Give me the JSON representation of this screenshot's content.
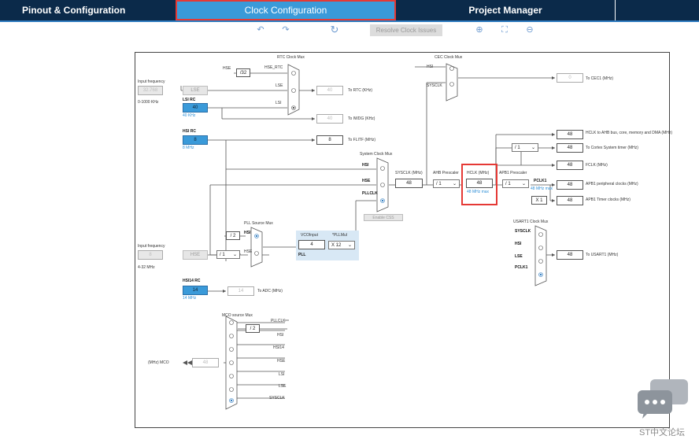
{
  "tabs": {
    "pinout": "Pinout & Configuration",
    "clock": "Clock Configuration",
    "project": "Project Manager"
  },
  "toolbar": {
    "resolve": "Resolve Clock Issues"
  },
  "input_freq": {
    "label": "Input frequency",
    "value": "32.768",
    "range": "0-1000 KHz"
  },
  "input_freq2": {
    "label": "Input frequency",
    "value": "8",
    "range": "4-32 MHz"
  },
  "lse": "LSE",
  "lsi_rc": {
    "label": "LSI RC",
    "value": "40",
    "unit": "40 KHz"
  },
  "hsi_rc": {
    "label": "HSI RC",
    "value": "8",
    "unit": "8 MHz"
  },
  "hse": "HSE",
  "hsi14_rc": {
    "label": "HSI14 RC",
    "value": "14",
    "unit": "14 MHz"
  },
  "rtc_mux": {
    "title": "RTC Clock Mux",
    "hse": "HSE",
    "div": "/32",
    "hse_rtc": "HSE_RTC",
    "lse": "LSE",
    "lsi": "LSI"
  },
  "rtc_out": {
    "value": "40",
    "label": "To RTC (KHz)"
  },
  "iwdg_out": {
    "value": "40",
    "label": "To IWDG (KHz)"
  },
  "flitf_out": {
    "value": "8",
    "label": "To FLITF (MHz)"
  },
  "cec_mux": {
    "title": "CEC Clock Mux",
    "hsi": "HSI",
    "sysclk": "SYSCLK"
  },
  "cec_out": {
    "value": "0",
    "label": "To CEC1 (MHz)"
  },
  "sys_mux": {
    "title": "System Clock Mux",
    "hsi": "HSI",
    "hse": "HSE",
    "pllclk": "PLLCLK",
    "css": "Enable CSS"
  },
  "sysclk": {
    "label": "SYSCLK (MHz)",
    "value": "48"
  },
  "ahb": {
    "label": "AHB Prescaler",
    "value": "/ 1"
  },
  "hclk": {
    "label": "HCLK (MHz)",
    "value": "48",
    "max": "48 MHz max"
  },
  "apb1": {
    "label": "APB1 Prescaler",
    "value": "/ 1",
    "pclk1": "PCLK1",
    "max": "48 MHz max"
  },
  "outputs": [
    {
      "value": "48",
      "label": "HCLK to AHB bus, core, memory and DMA (MHz)"
    },
    {
      "value": "48",
      "label": "To Cortex System timer (MHz)"
    },
    {
      "value": "48",
      "label": "FCLK (MHz)"
    },
    {
      "value": "48",
      "label": "APB1 peripheral clocks (MHz)"
    },
    {
      "value": "48",
      "label": "APB1 Timer clocks (MHz)"
    }
  ],
  "cortex_div": "/ 1",
  "timer_mul": "X 1",
  "pll_mux": {
    "title": "PLL Source Mux",
    "div": "/ 2",
    "hsi": "HSI",
    "hse": "HSE"
  },
  "prediv": "/ 1",
  "vco": {
    "label": "VCOInput",
    "value": "4",
    "pllmul": "*PLLMul",
    "mul": "X 12",
    "pll": "PLL"
  },
  "adc_out": {
    "value": "14",
    "label": "To ADC (MHz)"
  },
  "usart_mux": {
    "title": "USART1 Clock Mux",
    "items": [
      "SYSCLK",
      "HSI",
      "LSE",
      "PCLK1"
    ]
  },
  "usart_out": {
    "value": "48",
    "label": "To USART1 (MHz)"
  },
  "mco_mux": {
    "title": "MCO source Mux",
    "div": "/ 2",
    "items": [
      "PLLCLK",
      "HSI",
      "HSI14",
      "HSE",
      "LSI",
      "LSE",
      "SYSCLK"
    ]
  },
  "mco_out": {
    "label": "(MHz) MCO",
    "value": "48"
  },
  "watermark": "ST中文论坛",
  "colors": {
    "accent": "#3a9ad9",
    "navy": "#0b2a4a",
    "highlight": "#e53935"
  }
}
